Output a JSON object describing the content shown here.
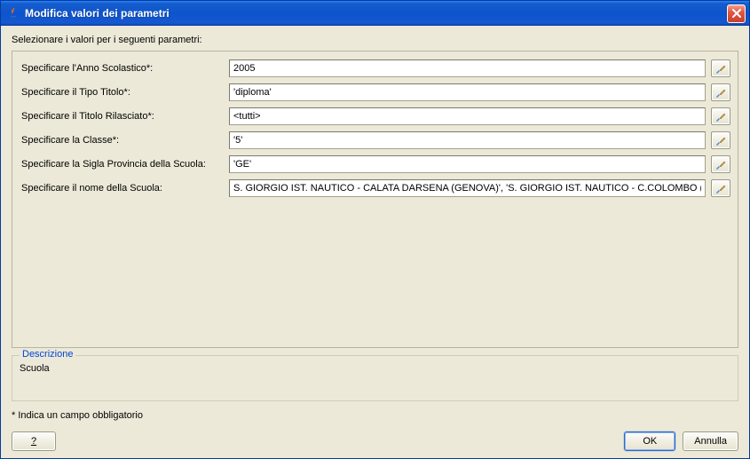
{
  "window": {
    "title": "Modifica valori dei parametri"
  },
  "prompt": "Selezionare i valori per i seguenti parametri:",
  "params": [
    {
      "label": "Specificare l'Anno Scolastico*:",
      "value": "2005"
    },
    {
      "label": "Specificare il Tipo Titolo*:",
      "value": "'diploma'"
    },
    {
      "label": "Specificare il Titolo Rilasciato*:",
      "value": "<tutti>"
    },
    {
      "label": "Specificare la Classe*:",
      "value": "'5'"
    },
    {
      "label": "Specificare la Sigla Provincia della Scuola:",
      "value": "'GE'"
    },
    {
      "label": "Specificare il nome della Scuola:",
      "value": "S. GIORGIO IST. NAUTICO - CALATA DARSENA (GENOVA)', 'S. GIORGIO IST. NAUTICO - C.COLOMBO (CAMOGLI)'"
    }
  ],
  "description": {
    "legend": "Descrizione",
    "body": "Scuola"
  },
  "required_note": "* Indica un campo obbligatorio",
  "buttons": {
    "help": "?",
    "ok": "OK",
    "cancel": "Annulla"
  },
  "icons": {
    "lookup": "brush-icon",
    "close": "close-icon",
    "app": "java-icon"
  }
}
